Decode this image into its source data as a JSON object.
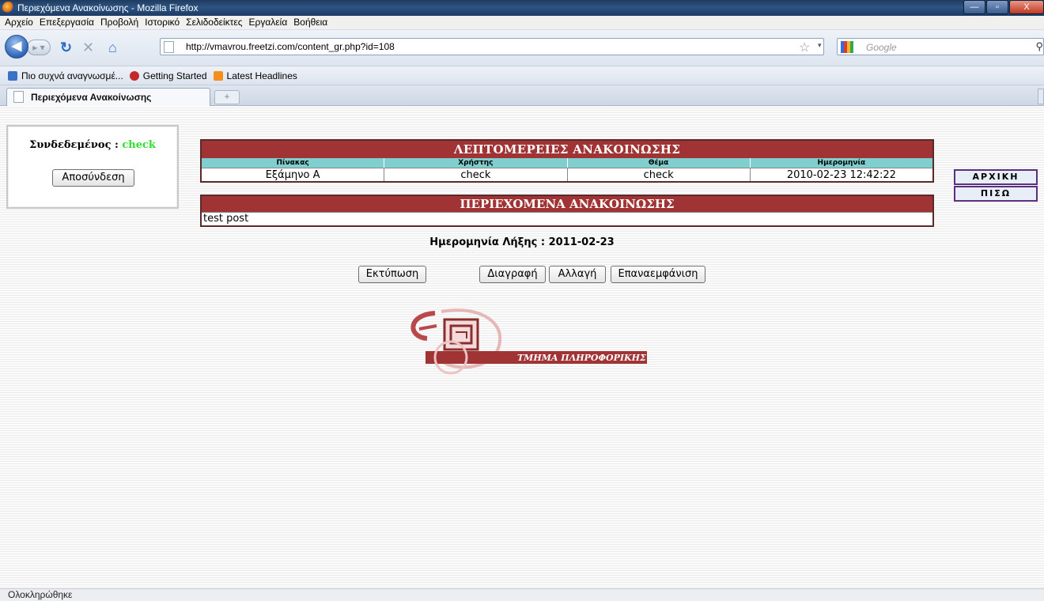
{
  "window": {
    "title": "Περιεχόμενα Ανακοίνωσης - Mozilla Firefox",
    "controls": {
      "minimize": "—",
      "maximize": "▫",
      "close": "X"
    }
  },
  "menu": [
    "Αρχείο",
    "Επεξεργασία",
    "Προβολή",
    "Ιστορικό",
    "Σελιδοδείκτες",
    "Εργαλεία",
    "Βοήθεια"
  ],
  "navbar": {
    "url": "http://vmavrou.freetzi.com/content_gr.php?id=108",
    "search_placeholder": "Google"
  },
  "bookmarks": [
    "Πιο συχνά αναγνωσμέ...",
    "Getting Started",
    "Latest Headlines"
  ],
  "tab": {
    "label": "Περιεχόμενα Ανακοίνωσης"
  },
  "login": {
    "label": "Συνδεδεμένος : ",
    "user": "check",
    "logout": "Αποσύνδεση"
  },
  "details": {
    "title": "ΛΕΠΤΟΜΕΡΕΙΕΣ ΑΝΑΚΟΙΝΩΣΗΣ",
    "headers": [
      "Πίνακας",
      "Χρήστης",
      "Θέμα",
      "Ημερομηνία"
    ],
    "values": [
      "Εξάμηνο Α",
      "check",
      "check",
      "2010-02-23 12:42:22"
    ]
  },
  "contents": {
    "title": "ΠΕΡΙΕΧΟΜΕΝΑ ΑΝΑΚΟΙΝΩΣΗΣ",
    "text": "test post"
  },
  "side_nav": {
    "home": "ΑΡΧΙΚΗ",
    "back": "ΠΙΣΩ"
  },
  "expiry": "Ημερομηνία Λήξης : 2011-02-23",
  "actions": {
    "print": "Εκτύπωση",
    "delete": "Διαγραφή",
    "edit": "Αλλαγή",
    "republish": "Επαναεμφάνιση"
  },
  "logo": {
    "text": "ΤΜΗΜΑ ΠΛΗΡΟΦΟΡΙΚΗΣ"
  },
  "status": "Ολοκληρώθηκε",
  "colors": {
    "header_red": "#a03434",
    "column_header_cyan": "#7fcfcf",
    "logged_user_green": "#33dd33",
    "side_nav_border": "#5c2f7d"
  }
}
